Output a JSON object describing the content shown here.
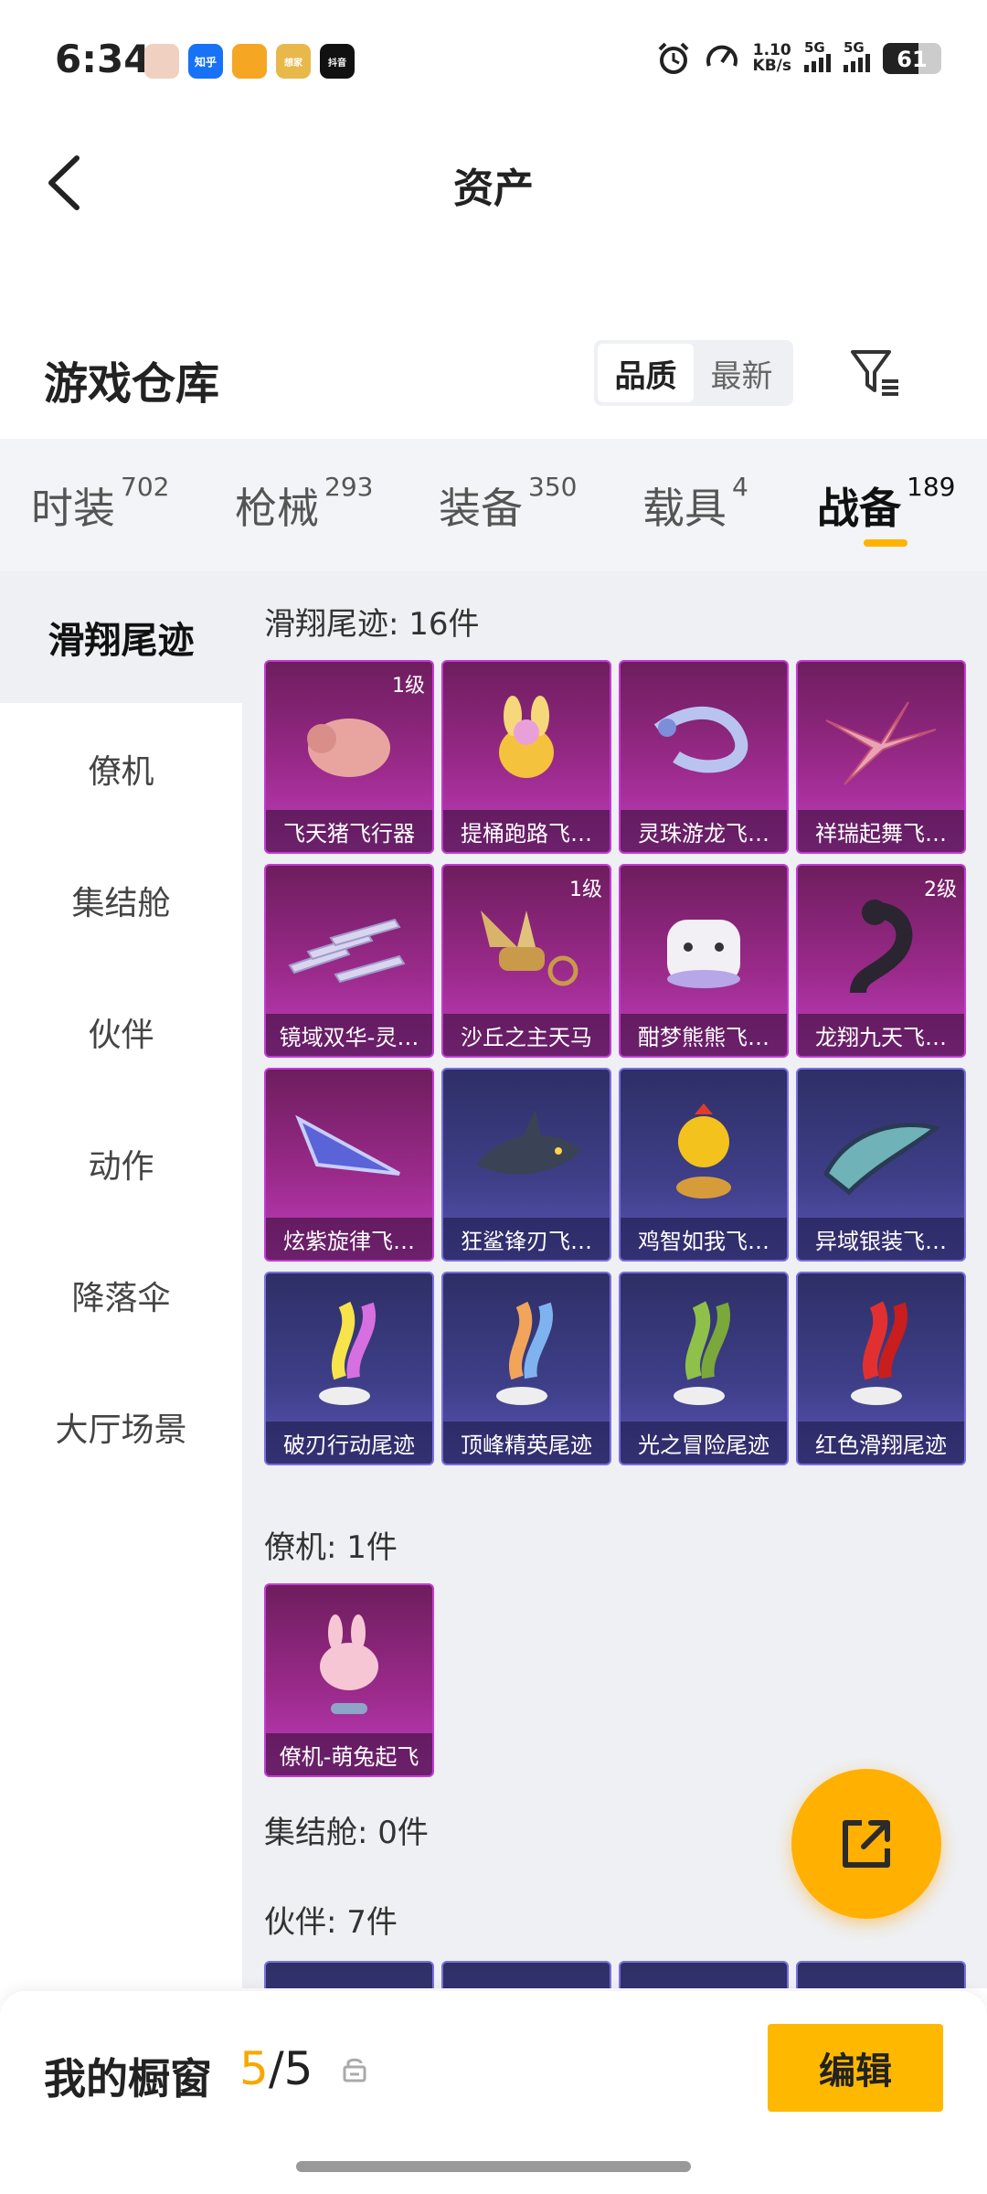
{
  "status_bar": {
    "time": "6:34",
    "apps": [
      "知乎",
      "想家",
      "抖音"
    ],
    "net_speed_value": "1.10",
    "net_speed_unit": "KB/s",
    "sig1": "5G",
    "sig2": "5G",
    "battery": "61",
    "battery_level": 0.61
  },
  "header": {
    "title": "资产"
  },
  "warehouse": {
    "title": "游戏仓库",
    "sort_options": [
      "品质",
      "最新"
    ],
    "active_sort": "品质"
  },
  "tabs": [
    {
      "label": "时装",
      "count": "702"
    },
    {
      "label": "枪械",
      "count": "293"
    },
    {
      "label": "装备",
      "count": "350"
    },
    {
      "label": "载具",
      "count": "4"
    },
    {
      "label": "战备",
      "count": "189"
    }
  ],
  "active_tab": "战备",
  "left_nav": [
    "滑翔尾迹",
    "僚机",
    "集结舱",
    "伙伴",
    "动作",
    "降落伞",
    "大厅场景"
  ],
  "active_nav": "滑翔尾迹",
  "sections": {
    "glide_trail": {
      "title": "滑翔尾迹: 16件",
      "items": [
        {
          "name": "飞天猪飞行器",
          "level": "1级"
        },
        {
          "name": "提桶跑路飞…",
          "level": ""
        },
        {
          "name": "灵珠游龙飞…",
          "level": ""
        },
        {
          "name": "祥瑞起舞飞…",
          "level": ""
        },
        {
          "name": "镜域双华-灵…",
          "level": ""
        },
        {
          "name": "沙丘之主天马",
          "level": "1级"
        },
        {
          "name": "酣梦熊熊飞…",
          "level": ""
        },
        {
          "name": "龙翔九天飞…",
          "level": "2级"
        },
        {
          "name": "炫紫旋律飞…",
          "level": ""
        },
        {
          "name": "狂鲨锋刃飞…",
          "level": ""
        },
        {
          "name": "鸡智如我飞…",
          "level": ""
        },
        {
          "name": "异域银装飞…",
          "level": ""
        },
        {
          "name": "破刃行动尾迹",
          "level": ""
        },
        {
          "name": "顶峰精英尾迹",
          "level": ""
        },
        {
          "name": "光之冒险尾迹",
          "level": ""
        },
        {
          "name": "红色滑翔尾迹",
          "level": ""
        }
      ]
    },
    "wingman": {
      "title": "僚机: 1件",
      "items": [
        {
          "name": "僚机-萌兔起飞"
        }
      ]
    },
    "capsule": {
      "title": "集结舱: 0件"
    },
    "partner": {
      "title": "伙伴: 7件"
    }
  },
  "bottom": {
    "showcase_label": "我的橱窗",
    "showcase_current": "5",
    "showcase_total": "/5",
    "edit_label": "编辑"
  }
}
